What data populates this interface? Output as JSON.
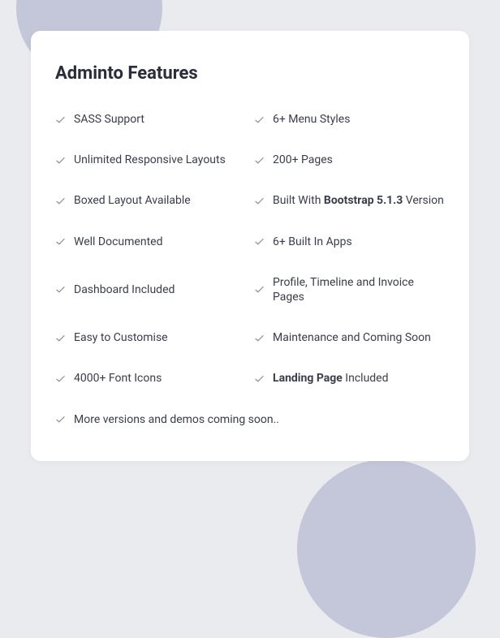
{
  "title": "Adminto Features",
  "features": {
    "col1": {
      "0": "SASS Support",
      "1": "Unlimited Responsive Layouts",
      "2": "Boxed Layout Available",
      "3": "Well Documented",
      "4": "Dashboard Included",
      "5": "Easy to Customise",
      "6": "4000+ Font Icons"
    },
    "col2": {
      "0": "6+ Menu Styles",
      "1": "200+ Pages",
      "2_pre": "Built With ",
      "2_bold": "Bootstrap 5.1.3",
      "2_post": " Version",
      "3": "6+ Built In Apps",
      "4": "Profile, Timeline and Invoice Pages",
      "5": "Maintenance and Coming Soon",
      "6_bold": "Landing Page",
      "6_post": " Included"
    },
    "footer": "More versions  and demos coming soon.."
  }
}
